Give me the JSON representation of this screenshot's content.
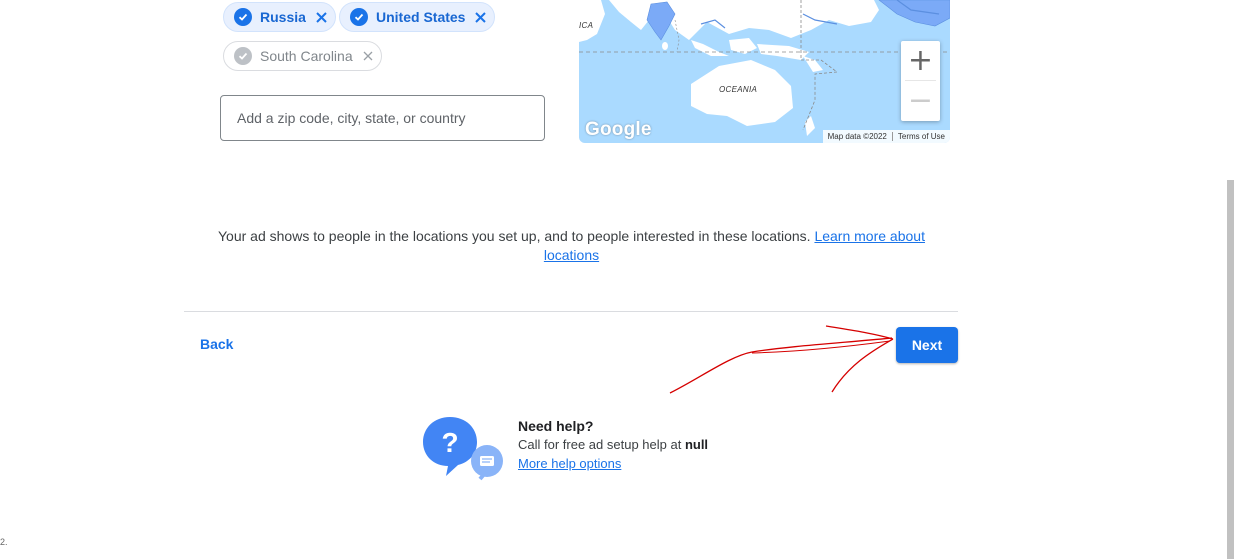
{
  "locations": {
    "chips": [
      {
        "label": "Russia",
        "state": "included"
      },
      {
        "label": "United States",
        "state": "included"
      },
      {
        "label": "South Carolina",
        "state": "disabled"
      }
    ],
    "input_placeholder": "Add a zip code, city, state, or country"
  },
  "map": {
    "labels": {
      "left_edge": "ICA",
      "oceania": "OCEANIA"
    },
    "logo_text": "Google",
    "attribution": "Map data ©2022",
    "terms": "Terms of Use",
    "zoom_in": "+",
    "zoom_out": "−"
  },
  "info": {
    "text": "Your ad shows to people in the locations you set up, and to people interested in these locations. ",
    "link_text": "Learn more about locations"
  },
  "nav": {
    "back_label": "Back",
    "next_label": "Next"
  },
  "help": {
    "title": "Need help?",
    "text_prefix": "Call for free ad setup help at ",
    "phone": "null",
    "link": "More help options"
  },
  "page_number": "2.",
  "colors": {
    "accent": "#1a73e8",
    "annotation": "#d50000",
    "map_water": "#aadaff",
    "map_land": "#ffffff",
    "map_highlight": "#7baaf7"
  }
}
